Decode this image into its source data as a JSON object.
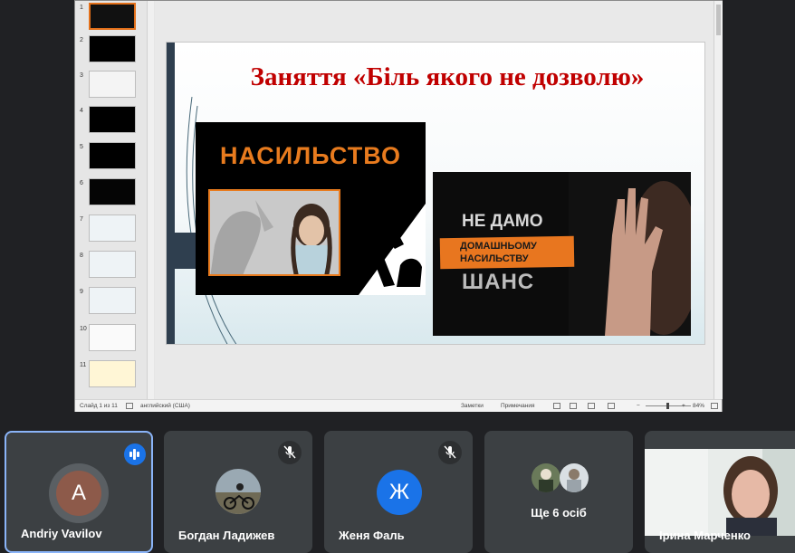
{
  "presentation": {
    "thumbnails": [
      {
        "num": "1",
        "selected": true
      },
      {
        "num": "2"
      },
      {
        "num": "3"
      },
      {
        "num": "4"
      },
      {
        "num": "5"
      },
      {
        "num": "6"
      },
      {
        "num": "7"
      },
      {
        "num": "8"
      },
      {
        "num": "9"
      },
      {
        "num": "10"
      },
      {
        "num": "11"
      }
    ],
    "slide": {
      "title": "Заняття «Біль якого не дозволю»",
      "image1_text": "НАСИЛЬСТВО",
      "image2_line1": "НЕ ДАМО",
      "image2_line2": "ДОМАШНЬОМУ",
      "image2_line3": "НАСИЛЬСТВУ",
      "image2_line4": "ШАНС"
    },
    "status": {
      "slide_info": "Слайд 1 из 11",
      "language": "английский (США)",
      "notes": "Заметки",
      "comments": "Примечания",
      "zoom": "84%"
    }
  },
  "participants": [
    {
      "name": "Andriy Vavilov",
      "initial": "A",
      "avatar_color": "#8d5a4a",
      "speaking": true
    },
    {
      "name": "Богдан Ладижев",
      "muted": true
    },
    {
      "name": "Женя Фаль",
      "initial": "Ж",
      "avatar_color": "#1a73e8",
      "muted": true
    },
    {
      "name": "Ще 6 осіб"
    },
    {
      "name": "Ірина Марченко"
    }
  ],
  "colors": {
    "meet_bg": "#202124",
    "tile_bg": "#3c4043",
    "speaking_border": "#8ab4f8",
    "accent_blue": "#1a73e8",
    "slide_title": "#c00000",
    "orange": "#e87b1e"
  }
}
